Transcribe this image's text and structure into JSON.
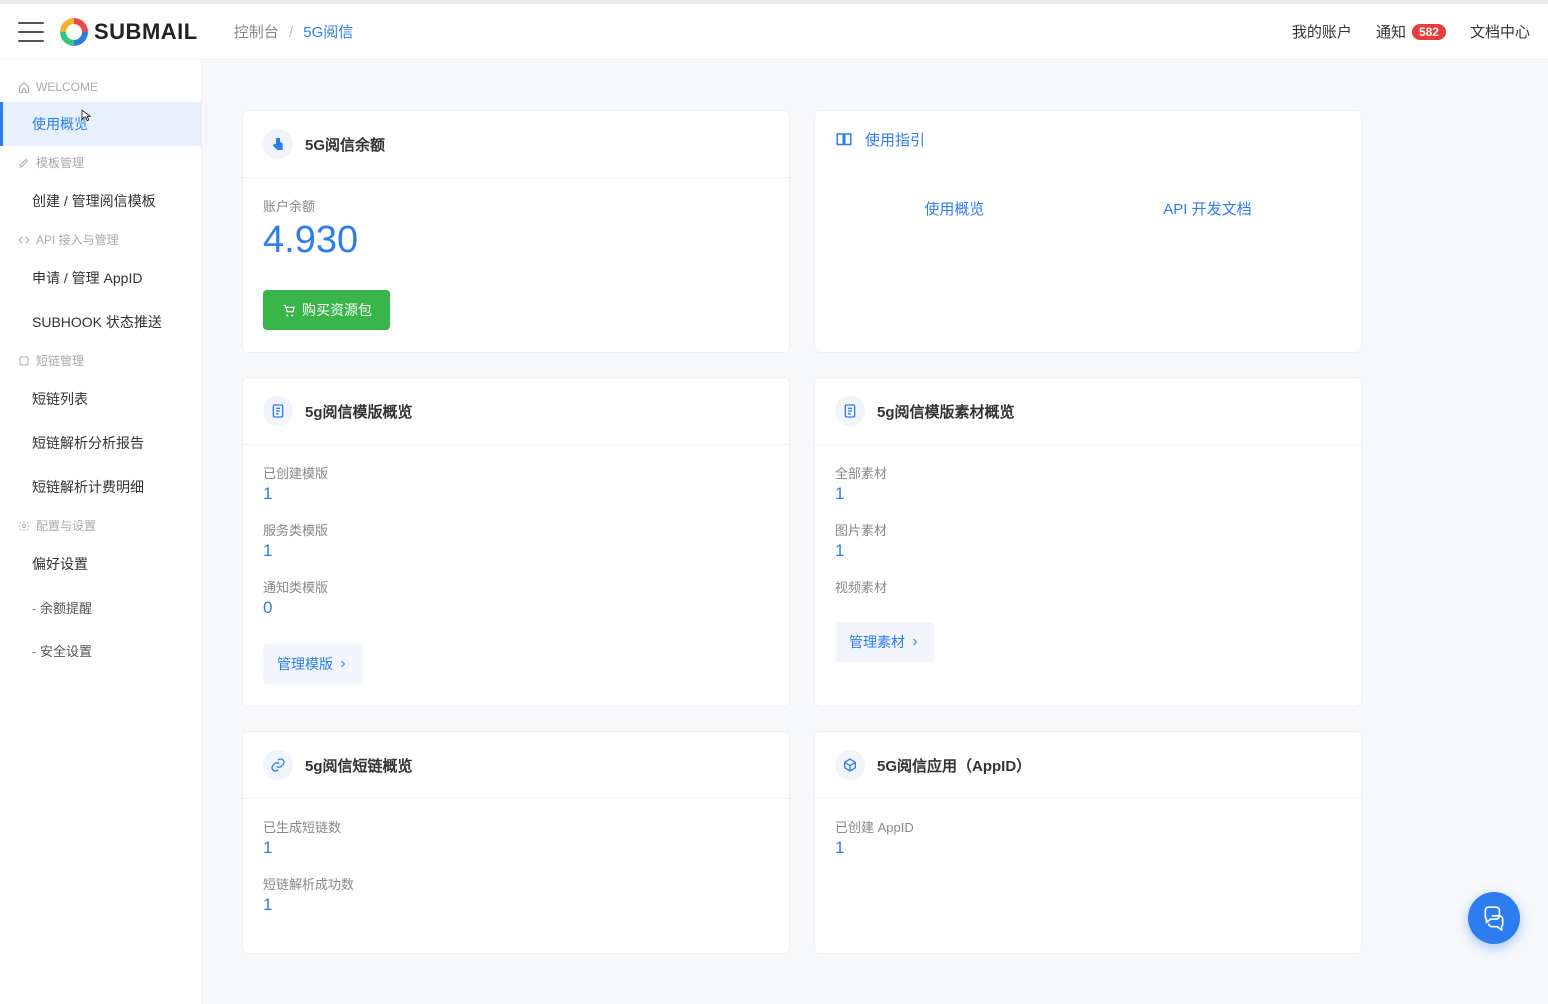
{
  "header": {
    "logo_text": "SUBMAIL",
    "breadcrumb_root": "控制台",
    "breadcrumb_current": "5G阅信",
    "my_account": "我的账户",
    "notifications": "通知",
    "notif_count": "582",
    "doc_center": "文档中心"
  },
  "sidebar": {
    "section_welcome": "WELCOME",
    "item_overview": "使用概览",
    "section_template": "模板管理",
    "item_create_template": "创建 / 管理阅信模板",
    "section_api": "API 接入与管理",
    "item_appid": "申请 / 管理 AppID",
    "item_subhook": "SUBHOOK 状态推送",
    "section_shortlink": "短链管理",
    "item_shortlink_list": "短链列表",
    "item_shortlink_report": "短链解析分析报告",
    "item_shortlink_billing": "短链解析计费明细",
    "section_config": "配置与设置",
    "item_preferences": "偏好设置",
    "item_balance_alert": "余额提醒",
    "item_security": "安全设置"
  },
  "cards": {
    "balance": {
      "title": "5G阅信余额",
      "label": "账户余额",
      "value": "4.930",
      "buy_button": "购买资源包"
    },
    "guide": {
      "title": "使用指引",
      "link_overview": "使用概览",
      "link_api_docs": "API 开发文档"
    },
    "template_overview": {
      "title": "5g阅信模版概览",
      "stat1_label": "已创建模版",
      "stat1_value": "1",
      "stat2_label": "服务类模版",
      "stat2_value": "1",
      "stat3_label": "通知类模版",
      "stat3_value": "0",
      "manage_button": "管理模版"
    },
    "material_overview": {
      "title": "5g阅信模版素材概览",
      "stat1_label": "全部素材",
      "stat1_value": "1",
      "stat2_label": "图片素材",
      "stat2_value": "1",
      "stat3_label": "视频素材",
      "stat3_value": "",
      "manage_button": "管理素材"
    },
    "shortlink_overview": {
      "title": "5g阅信短链概览",
      "stat1_label": "已生成短链数",
      "stat1_value": "1",
      "stat2_label": "短链解析成功数",
      "stat2_value": "1"
    },
    "appid_overview": {
      "title": "5G阅信应用（AppID）",
      "stat1_label": "已创建 AppID",
      "stat1_value": "1"
    }
  }
}
